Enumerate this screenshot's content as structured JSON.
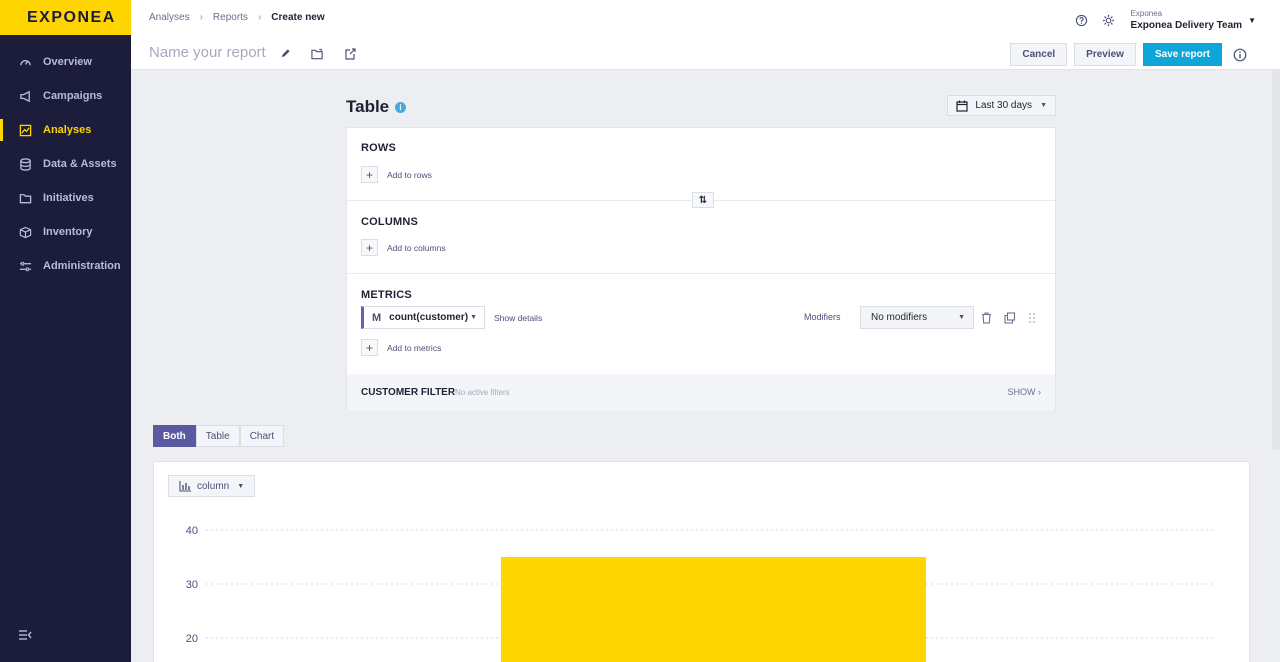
{
  "sidebar": {
    "logo": "EXPONEA",
    "items": [
      {
        "label": "Overview",
        "icon": "gauge-icon"
      },
      {
        "label": "Campaigns",
        "icon": "megaphone-icon"
      },
      {
        "label": "Analyses",
        "icon": "chart-icon",
        "active": true
      },
      {
        "label": "Data & Assets",
        "icon": "database-icon"
      },
      {
        "label": "Initiatives",
        "icon": "folder-icon"
      },
      {
        "label": "Inventory",
        "icon": "box-icon"
      },
      {
        "label": "Administration",
        "icon": "sliders-icon"
      }
    ]
  },
  "breadcrumb": {
    "items": [
      "Analyses",
      "Reports"
    ],
    "current": "Create new"
  },
  "account": {
    "org": "Exponea",
    "team": "Exponea Delivery Team"
  },
  "report": {
    "name_placeholder": "Name your report"
  },
  "actions": {
    "cancel": "Cancel",
    "preview": "Preview",
    "save": "Save report"
  },
  "builder": {
    "title": "Table",
    "date_range": "Last 30 days",
    "rows": {
      "title": "ROWS",
      "add": "Add to rows"
    },
    "columns": {
      "title": "COLUMNS",
      "add": "Add to columns"
    },
    "metrics": {
      "title": "METRICS",
      "metric_badge": "M",
      "metric_name": "count(customer)",
      "show_details": "Show details",
      "modifiers_label": "Modifiers",
      "modifiers_value": "No modifiers",
      "add": "Add to metrics"
    },
    "customer_filter": {
      "title": "CUSTOMER FILTER",
      "status": "No active filters",
      "show": "SHOW"
    }
  },
  "view_tabs": [
    {
      "label": "Both",
      "active": true
    },
    {
      "label": "Table",
      "active": false
    },
    {
      "label": "Chart",
      "active": false
    }
  ],
  "chart_type": "column",
  "colors": {
    "brand": "#ffd500",
    "sidebar": "#1c1c3b",
    "primary": "#0ea5d8",
    "active_tab": "#5a5aa0"
  },
  "chart_data": {
    "type": "bar",
    "y_ticks": [
      40,
      30,
      20
    ],
    "ylim": [
      0,
      40
    ],
    "values": [
      35
    ],
    "color": "#ffd500",
    "grid": true
  }
}
